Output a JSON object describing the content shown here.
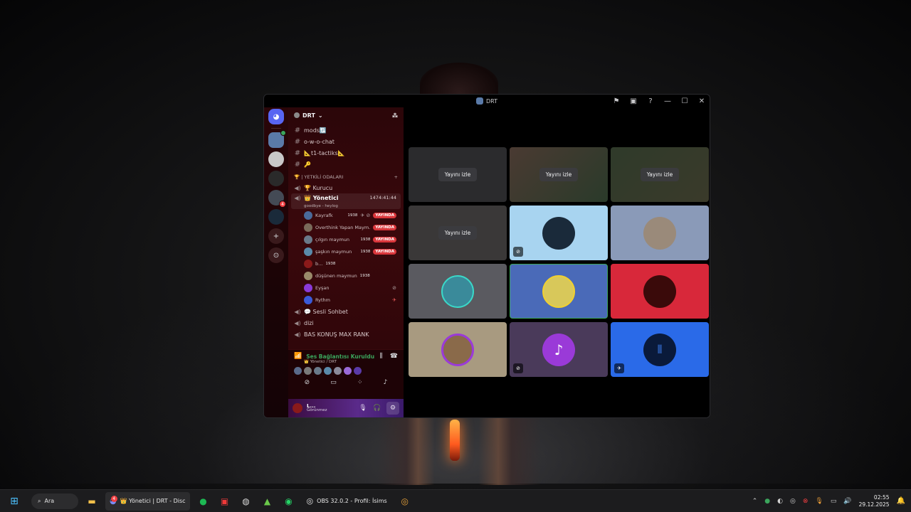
{
  "window": {
    "title": "DRT",
    "actions": [
      "⚑",
      "▣",
      "?",
      "—",
      "☐",
      "✕"
    ]
  },
  "rail": {
    "servers": [
      {
        "name": "home",
        "glyph": "◕"
      },
      {
        "name": "drt",
        "glyph": "",
        "color": "#5a7aa8",
        "green_dot": true
      },
      {
        "name": "user1",
        "glyph": "",
        "color": "#c8c8c8"
      },
      {
        "name": "user2",
        "glyph": "",
        "color": "#2a2a2a"
      },
      {
        "name": "server4",
        "glyph": "",
        "color": "#444a55",
        "badge": "4"
      },
      {
        "name": "server5",
        "glyph": "",
        "color": "#1a2a3a"
      }
    ],
    "add_glyph": "+",
    "explore_glyph": "⊙"
  },
  "sidebar": {
    "server_name": "DRT",
    "channels_text": [
      {
        "name": "mods🔃"
      },
      {
        "name": "o-w-o-chat"
      },
      {
        "name": "📐t1-tactiks📐"
      },
      {
        "name": "🔑"
      }
    ],
    "category": "🏆 | YETKİLİ ODALARI",
    "voice_before": [
      {
        "name": "🏆 Kurucu"
      }
    ],
    "active_channel": {
      "name": "👑 Yönetici",
      "timer": "1474:41:44",
      "sub": "goodbye - heylog"
    },
    "members": [
      {
        "name": "Kayrafk",
        "tag": "1938",
        "live": "YAYINDA",
        "color": "#4a6a9a",
        "icons": "✈ ⊘"
      },
      {
        "name": "Overthink Yapan Maym...",
        "tag": "",
        "live": "YAYINDA",
        "color": "#7a6a5a",
        "icons": ""
      },
      {
        "name": "çılgın maymun",
        "tag": "1938",
        "live": "YAYINDA",
        "color": "#6a7a8a",
        "icons": ""
      },
      {
        "name": "şaşkın maymun",
        "tag": "1938",
        "live": "YAYINDA",
        "color": "#5a8aaa",
        "icons": ""
      },
      {
        "name": "b...",
        "tag": "1938",
        "live": "",
        "color": "#8a1a1a",
        "icons": ""
      },
      {
        "name": "düşünen maymun",
        "tag": "1938",
        "live": "",
        "color": "#9a8a6a",
        "icons": ""
      },
      {
        "name": "Eyşan",
        "tag": "",
        "live": "",
        "color": "#8a3ad8",
        "icons": "⊘"
      },
      {
        "name": "Rythm",
        "tag": "",
        "live": "",
        "color": "#3a5ad8",
        "icons": "✈"
      }
    ],
    "voice_after": [
      {
        "name": "💬 Sesli Sohbet"
      },
      {
        "name": "dizi"
      },
      {
        "name": "BAS KONUŞ MAX RANK"
      }
    ]
  },
  "voice_panel": {
    "title": "Ses Bağlantısı Kuruldu",
    "sub": "👑 Yönetici / DRT",
    "avatar_colors": [
      "#5a6a8a",
      "#7a7a7a",
      "#6a7a8a",
      "#5a8aaa",
      "#8a8a9a",
      "#9a6ad8",
      "#5a3aa8"
    ],
    "controls": [
      "⊘",
      "▭",
      "⁘",
      "♪"
    ]
  },
  "user_panel": {
    "name": "L...",
    "status": "Görünmez",
    "mic": "🎙",
    "headset": "🎧",
    "settings": "⚙"
  },
  "stage": {
    "watch_label": "Yayını izle",
    "tiles": [
      {
        "bg": "#2b2b2d",
        "type": "watch"
      },
      {
        "bg": "#3a3a34",
        "type": "watch"
      },
      {
        "bg": "#2f3a2a",
        "type": "watch"
      },
      {
        "bg": "#3a3838",
        "type": "watch"
      },
      {
        "bg": "#a8d4f0",
        "type": "avatar",
        "avatar": "#1a2a3a",
        "corner": "⊘"
      },
      {
        "bg": "#8a9ab8",
        "type": "avatar",
        "avatar": "#9a8a7a",
        "corner": ""
      },
      {
        "bg": "#5a5a60",
        "type": "avatar",
        "avatar": "#3a8a9a",
        "corner": ""
      },
      {
        "bg": "#4a6ab8",
        "type": "avatar",
        "avatar": "#d8c85a",
        "corner": ""
      },
      {
        "bg": "#d8283a",
        "type": "avatar",
        "avatar": "#3a0a0a",
        "corner": ""
      },
      {
        "bg": "#a89a80",
        "type": "avatar",
        "avatar": "#8a5ad8",
        "corner": ""
      },
      {
        "bg": "#4a3a5a",
        "type": "avatar",
        "avatar": "#9a3ad8",
        "corner": "⊘"
      },
      {
        "bg": "#2a6ae8",
        "type": "avatar",
        "avatar": "#0a1a3a",
        "corner": "✈"
      }
    ]
  },
  "taskbar": {
    "search_label": "Ara",
    "discord_label": "👑 Yönetici | DRT - Disc",
    "discord_badge": "4",
    "obs_label": "OBS 32.0.2 - Profil: İsims",
    "time": "02:55",
    "date": "29.12.2025"
  }
}
